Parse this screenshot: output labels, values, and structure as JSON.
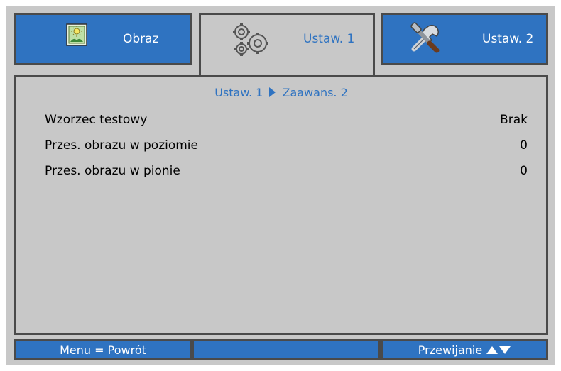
{
  "tabs": [
    {
      "label": "Obraz",
      "icon": "picture-icon",
      "active": false
    },
    {
      "label": "Ustaw. 1",
      "icon": "gears-icon",
      "active": true
    },
    {
      "label": "Ustaw. 2",
      "icon": "tools-icon",
      "active": false
    }
  ],
  "breadcrumb": {
    "part1": "Ustaw. 1",
    "part2": "Zaawans. 2"
  },
  "settings": [
    {
      "label": "Wzorzec testowy",
      "value": "Brak"
    },
    {
      "label": "Przes. obrazu w poziomie",
      "value": "0"
    },
    {
      "label": "Przes. obrazu w pionie",
      "value": "0"
    }
  ],
  "footer": {
    "left": "Menu = Powrót",
    "middle": "",
    "right": "Przewijanie"
  },
  "colors": {
    "accent": "#2f73c1",
    "panel": "#c8c8c8",
    "border": "#4a4a4a"
  }
}
